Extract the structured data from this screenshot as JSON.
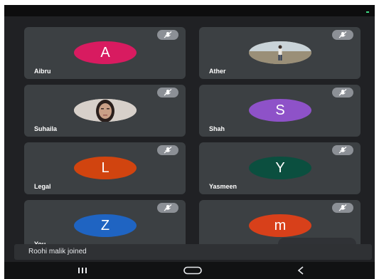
{
  "participants": [
    {
      "name": "Aibru",
      "type": "initial",
      "initial": "A",
      "color": "#d81b60"
    },
    {
      "name": "Ather",
      "type": "photo",
      "photo": "person-standing-outdoors"
    },
    {
      "name": "Suhaila",
      "type": "photo",
      "photo": "woman-portrait"
    },
    {
      "name": "Shah",
      "type": "initial",
      "initial": "S",
      "color": "#8e52c8"
    },
    {
      "name": "Legal",
      "type": "initial",
      "initial": "L",
      "color": "#d1440f"
    },
    {
      "name": "Yasmeen",
      "type": "initial",
      "initial": "Y",
      "color": "#0b4f3f"
    },
    {
      "name": "You",
      "type": "initial",
      "initial": "Z",
      "color": "#1f64c2"
    },
    {
      "name": "",
      "type": "initial",
      "initial": "m",
      "color": "#d8401a"
    }
  ],
  "mute_icon": "mic-off-icon",
  "toast": {
    "text": "Roohi malik joined"
  },
  "navbar": {
    "recents": "recents-icon",
    "home": "home-icon",
    "back": "back-icon"
  },
  "colors": {
    "background": "#202124",
    "tile": "#3c4043",
    "mute_badge": "#8c9096"
  }
}
